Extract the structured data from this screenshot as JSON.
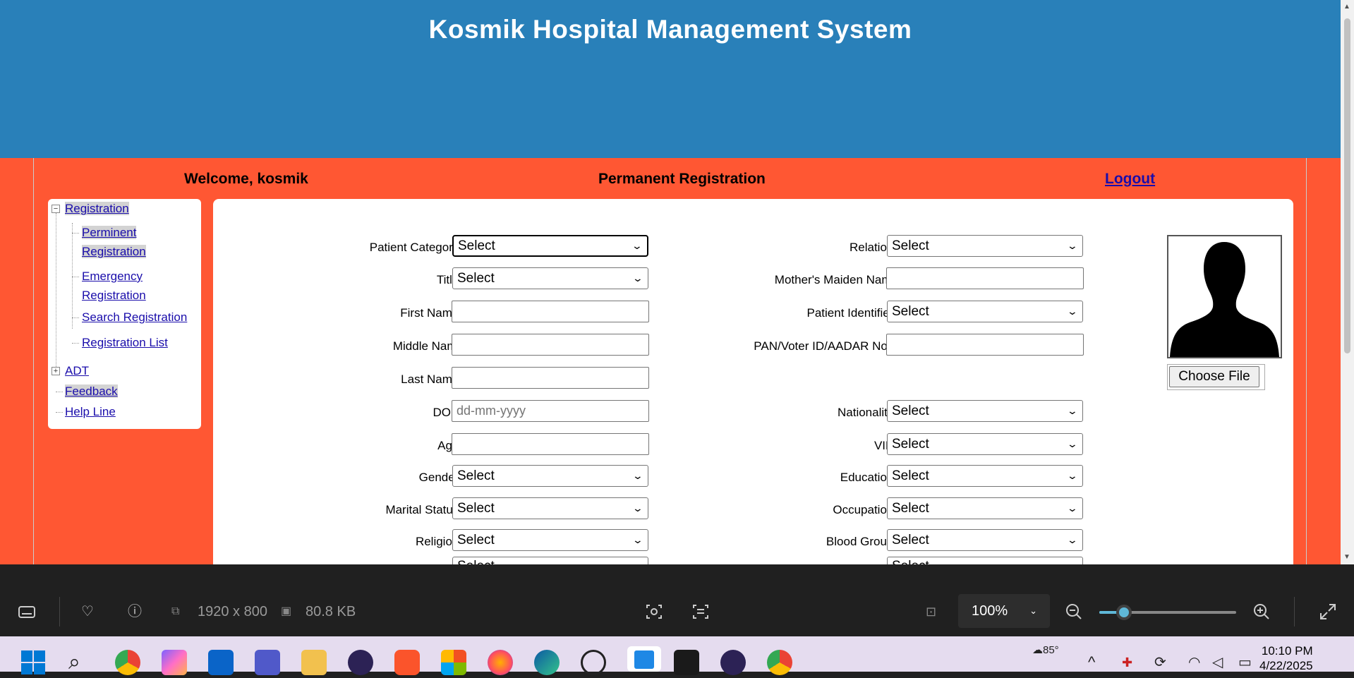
{
  "app": {
    "title": "Kosmik Hospital Management System"
  },
  "topbar": {
    "welcome": "Welcome, kosmik",
    "page_title": "Permanent Registration",
    "logout": "Logout"
  },
  "sidebar": {
    "registration": "Registration",
    "children": [
      "Perminent Registration",
      "Emergency Registration",
      "Search Registration",
      "Registration List"
    ],
    "adt": "ADT",
    "feedback": "Feedback",
    "helpline": "Help Line"
  },
  "form": {
    "left": [
      {
        "label": "Patient Category",
        "required": true,
        "type": "select",
        "value": "Select"
      },
      {
        "label": "Title",
        "required": true,
        "type": "select",
        "value": "Select"
      },
      {
        "label": "First Name",
        "required": true,
        "type": "text",
        "value": ""
      },
      {
        "label": "Middle Name",
        "required": false,
        "type": "text",
        "value": ""
      },
      {
        "label": "Last Name",
        "required": true,
        "type": "text",
        "value": ""
      },
      {
        "label": "DOB",
        "required": true,
        "type": "text",
        "placeholder": "dd-mm-yyyy"
      },
      {
        "label": "Age",
        "required": true,
        "type": "text",
        "value": ""
      },
      {
        "label": "Gender",
        "required": true,
        "type": "select",
        "value": "Select"
      },
      {
        "label": "Marital Status",
        "required": true,
        "type": "select",
        "value": "Select"
      },
      {
        "label": "Religion",
        "required": true,
        "type": "select",
        "value": "Select"
      }
    ],
    "right": [
      {
        "label": "Relation",
        "required": true,
        "type": "select",
        "value": "Select"
      },
      {
        "label": "Mother's Maiden Name",
        "required": false,
        "type": "text",
        "value": ""
      },
      {
        "label": "Patient Identifier",
        "required": true,
        "type": "select",
        "value": "Select"
      },
      {
        "label": "PAN/Voter ID/AADAR Nos",
        "required": true,
        "type": "text",
        "value": ""
      },
      {
        "label": "Nationality",
        "required": true,
        "type": "select",
        "value": "Select"
      },
      {
        "label": "VIP",
        "required": true,
        "type": "select",
        "value": "Select"
      },
      {
        "label": "Education",
        "required": true,
        "type": "select",
        "value": "Select"
      },
      {
        "label": "Occupation",
        "required": true,
        "type": "select",
        "value": "Select"
      },
      {
        "label": "Blood Group",
        "required": true,
        "type": "select",
        "value": "Select"
      }
    ],
    "required_mark": "*",
    "partial_select": "Select",
    "choose_file": "Choose File"
  },
  "viewer": {
    "dimensions": "1920 x 800",
    "file_size": "80.8 KB",
    "zoom": "100%",
    "zoom_level_fraction": 0.18
  },
  "taskbar": {
    "weather_temp": "85°",
    "time": "10:10 PM",
    "date": "4/22/2025"
  },
  "colors": {
    "header": "#2980b9",
    "background": "#ff5733",
    "link": "#1a0dab"
  }
}
